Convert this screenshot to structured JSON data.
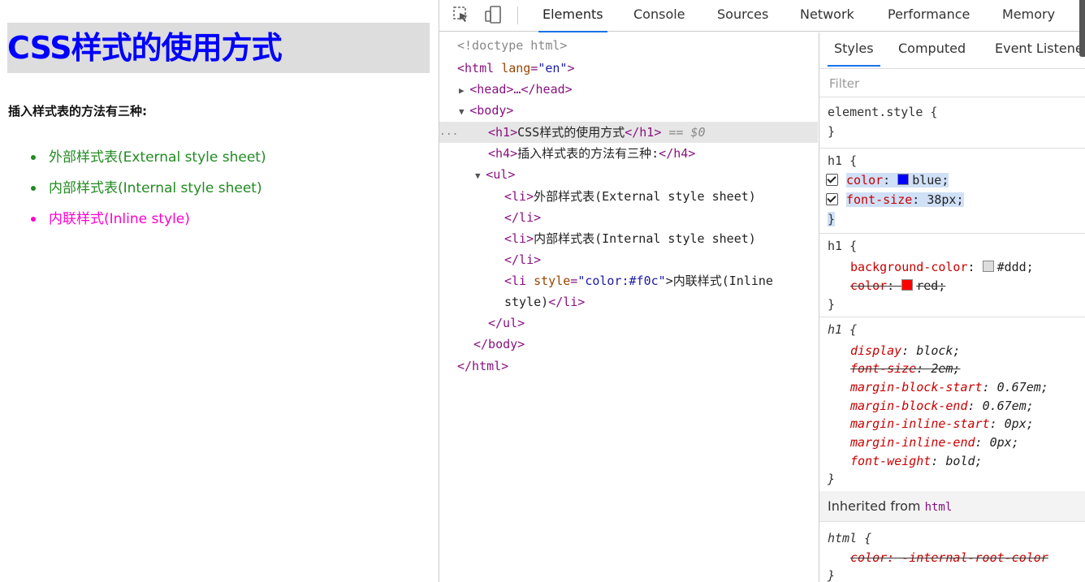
{
  "preview": {
    "h1": "CSS样式的使用方式",
    "h4": "插入样式表的方法有三种:",
    "items": [
      {
        "text": "外部样式表(External style sheet)",
        "color": "#228b22"
      },
      {
        "text": "内部样式表(Internal style sheet)",
        "color": "#228b22"
      },
      {
        "text": "内联样式(Inline style)",
        "color": "#ff00cc"
      }
    ]
  },
  "devtools": {
    "toolbar_icons": [
      "inspect-icon",
      "device-toggle-icon"
    ],
    "tabs": [
      "Elements",
      "Console",
      "Sources",
      "Network",
      "Performance",
      "Memory"
    ],
    "active_tab": "Elements",
    "dom": {
      "doctype": "<!doctype html>",
      "html_open_tag": "<html ",
      "html_attr": "lang",
      "html_attr_val": "\"en\"",
      "html_close_bracket": ">",
      "head": "<head>…</head>",
      "body_open": "<body>",
      "selected_marker": "...",
      "h1_open": "<h1>",
      "h1_text": "CSS样式的使用方式",
      "h1_close": "</h1>",
      "h1_ref": " == $0",
      "h4_open": "<h4>",
      "h4_text": "插入样式表的方法有三种:",
      "h4_close": "</h4>",
      "ul_open": "<ul>",
      "li1_open": "<li>",
      "li1_text": "外部样式表(External style sheet)",
      "li_close": "</li>",
      "li2_text": "内部样式表(Internal style sheet)",
      "li3_open": "<li ",
      "li3_attr": "style",
      "li3_val": "\"color:#f0c\"",
      "li3_text": ">内联样式(Inline",
      "li3_text2": "style)",
      "ul_close": "</ul>",
      "body_close": "</body>",
      "html_close": "</html>"
    },
    "styles": {
      "tabs": [
        "Styles",
        "Computed",
        "Event Listeners"
      ],
      "filter_placeholder": "Filter",
      "element_style": "element.style {",
      "close_brace": "}",
      "rule1_selector": "h1 {",
      "rule1_props": [
        {
          "name": "color",
          "value": "blue;",
          "swatch": "#0000ff"
        },
        {
          "name": "font-size",
          "value": "38px;"
        }
      ],
      "rule2_selector": "h1 {",
      "rule2_props": [
        {
          "name": "background-color",
          "value": "#ddd;",
          "swatch": "#dddddd"
        },
        {
          "name": "color",
          "value": "red;",
          "swatch": "#ff0000"
        }
      ],
      "rule3_selector": "h1 {",
      "rule3_props": [
        {
          "name": "display",
          "value": "block;"
        },
        {
          "name": "font-size",
          "value": "2em;"
        },
        {
          "name": "margin-block-start",
          "value": "0.67em;"
        },
        {
          "name": "margin-block-end",
          "value": "0.67em;"
        },
        {
          "name": "margin-inline-start",
          "value": "0px;"
        },
        {
          "name": "margin-inline-end",
          "value": "0px;"
        },
        {
          "name": "font-weight",
          "value": "bold;"
        }
      ],
      "inherited_label": "Inherited from",
      "inherited_from": "html",
      "html_rule_selector": "html {",
      "html_rule_prop": "color: -internal-root-color"
    }
  }
}
